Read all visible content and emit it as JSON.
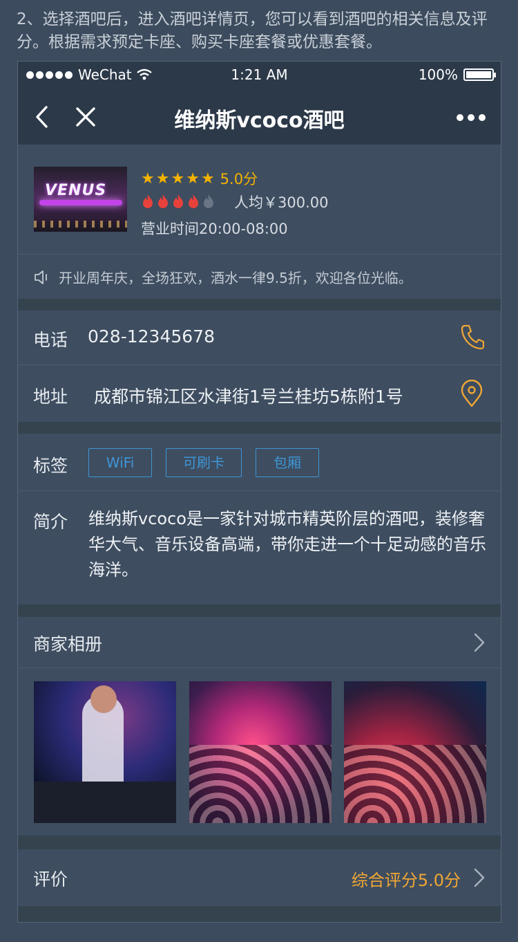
{
  "caption": "2、选择酒吧后，进入酒吧详情页，您可以看到酒吧的相关信息及评分。根据需求预定卡座、购买卡座套餐或优惠套餐。",
  "statusbar": {
    "carrier": "WeChat",
    "time": "1:21 AM",
    "battery": "100%"
  },
  "navbar": {
    "title": "维纳斯vcoco酒吧"
  },
  "bar": {
    "logo_text": "VENUS",
    "rating": 5,
    "rating_text": "5.0分",
    "heat": 4,
    "heat_max": 5,
    "avg_price": "人均￥300.00",
    "hours": "营业时间20:00-08:00"
  },
  "notice": {
    "text": "开业周年庆，全场狂欢，酒水一律9.5折，欢迎各位光临。"
  },
  "phone": {
    "label": "电话",
    "value": "028-12345678"
  },
  "address": {
    "label": "地址",
    "value": "成都市锦江区水津街1号兰桂坊5栋附1号"
  },
  "tags": {
    "label": "标签",
    "items": [
      "WiFi",
      "可刷卡",
      "包厢"
    ]
  },
  "intro": {
    "label": "简介",
    "text": "维纳斯vcoco是一家针对城市精英阶层的酒吧，装修奢华大气、音乐设备高端，带你走进一个十足动感的音乐海洋。"
  },
  "album": {
    "title": "商家相册"
  },
  "reviews": {
    "label": "评价",
    "score": "综合评分5.0分"
  },
  "colors": {
    "accent_orange": "#f0a733",
    "star_yellow": "#f5b301",
    "tag_blue": "#3e96d6",
    "flame_red": "#e8413b"
  }
}
